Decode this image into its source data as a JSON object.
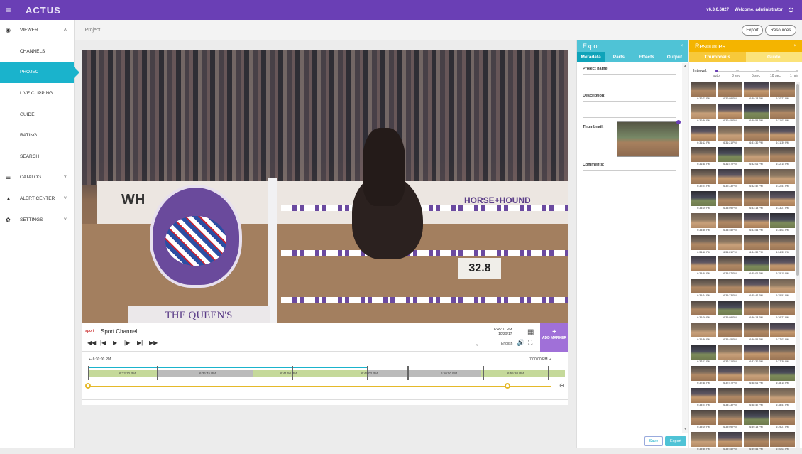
{
  "app": {
    "logo": "ACTUS",
    "version": "v6.3.0.6827",
    "welcome": "Welcome, administrator",
    "brand_color": "#6a3fb5",
    "accent_color": "#1ab3cc"
  },
  "sidebar": {
    "items": [
      {
        "label": "VIEWER",
        "icon": "eye-icon",
        "chevron": "˄"
      },
      {
        "label": "CHANNELS"
      },
      {
        "label": "PROJECT"
      },
      {
        "label": "LIVE CLIPPING"
      },
      {
        "label": "GUIDE"
      },
      {
        "label": "RATING"
      },
      {
        "label": "SEARCH"
      },
      {
        "label": "CATALOG",
        "icon": "list-icon",
        "chevron": "˅"
      },
      {
        "label": "ALERT CENTER",
        "icon": "bell-icon",
        "chevron": "˅"
      },
      {
        "label": "SETTINGS",
        "icon": "gear-icon",
        "chevron": "˅"
      }
    ]
  },
  "tabstrip": {
    "tab": "Project",
    "export_btn": "Export",
    "resources_btn": "Resources"
  },
  "video": {
    "scoreboard": "32.8",
    "sign_text": "THE QUEEN'S",
    "wall_text_1": "WH",
    "wall_text_2": "HORSE+HOUND"
  },
  "player": {
    "channel_logo": "sport",
    "channel_name": "Sport Channel",
    "time": "6:45:07 PM",
    "date": "10/29/17",
    "language": "English",
    "add_marker": "ADD MARKER",
    "add_marker_plus": "+",
    "level_top": "L",
    "level_bottom": "R",
    "controls": {
      "rewind": "◀◀",
      "prev": "|◀",
      "play": "▶",
      "step": "|▶",
      "next": "▶|",
      "ff": "▶▶"
    }
  },
  "timeline": {
    "start": "6:30:00 PM",
    "end": "7:00:00 PM",
    "labels": [
      "6:33:10 PM",
      "6:36:45 PM",
      "6:41:50 PM",
      "6:45:03 PM",
      "6:50:50 PM",
      "6:55:20 PM"
    ]
  },
  "export_panel": {
    "title": "Export",
    "close": "×",
    "tabs": [
      "Metadata",
      "Parts",
      "Effects",
      "Output"
    ],
    "fields": {
      "project_name": "Project name:",
      "description": "Description:",
      "thumbnail": "Thumbnail:",
      "comments": "Comments:"
    },
    "save": "Save",
    "export": "Export"
  },
  "resources_panel": {
    "title": "Resources",
    "close": "×",
    "tabs": [
      "Thumbnails",
      "Guide"
    ],
    "interval_label": "Interval:",
    "interval_options": [
      "auto",
      "3 sec",
      "5 sec",
      "10 sec",
      "1 min"
    ],
    "selected_interval": "auto",
    "thumbnails": [
      "6:30:03 PM",
      "6:30:09 PM",
      "6:30:18 PM",
      "6:30:27 PM",
      "6:30:36 PM",
      "6:30:45 PM",
      "6:30:54 PM",
      "6:31:03 PM",
      "6:31:12 PM",
      "6:31:21 PM",
      "6:31:30 PM",
      "6:31:39 PM",
      "6:31:48 PM",
      "6:31:57 PM",
      "6:32:06 PM",
      "6:32:15 PM",
      "6:32:24 PM",
      "6:32:33 PM",
      "6:32:42 PM",
      "6:32:51 PM",
      "6:33:00 PM",
      "6:33:09 PM",
      "6:33:18 PM",
      "6:33:27 PM",
      "6:33:36 PM",
      "6:33:45 PM",
      "6:33:54 PM",
      "6:34:03 PM",
      "6:34:12 PM",
      "6:34:21 PM",
      "6:34:30 PM",
      "6:34:39 PM",
      "6:34:48 PM",
      "6:34:57 PM",
      "6:35:06 PM",
      "6:35:15 PM",
      "6:35:24 PM",
      "6:35:33 PM",
      "6:35:42 PM",
      "6:35:51 PM",
      "6:36:00 PM",
      "6:36:09 PM",
      "6:36:18 PM",
      "6:36:27 PM",
      "6:36:36 PM",
      "6:36:45 PM",
      "6:36:54 PM",
      "6:37:03 PM",
      "6:37:12 PM",
      "6:37:21 PM",
      "6:37:30 PM",
      "6:37:39 PM",
      "6:37:48 PM",
      "6:37:57 PM",
      "6:38:06 PM",
      "6:38:15 PM",
      "6:38:24 PM",
      "6:38:33 PM",
      "6:38:42 PM",
      "6:38:51 PM",
      "6:39:00 PM",
      "6:39:09 PM",
      "6:39:18 PM",
      "6:39:27 PM",
      "6:39:36 PM",
      "6:39:45 PM",
      "6:39:54 PM",
      "6:40:03 PM"
    ]
  }
}
